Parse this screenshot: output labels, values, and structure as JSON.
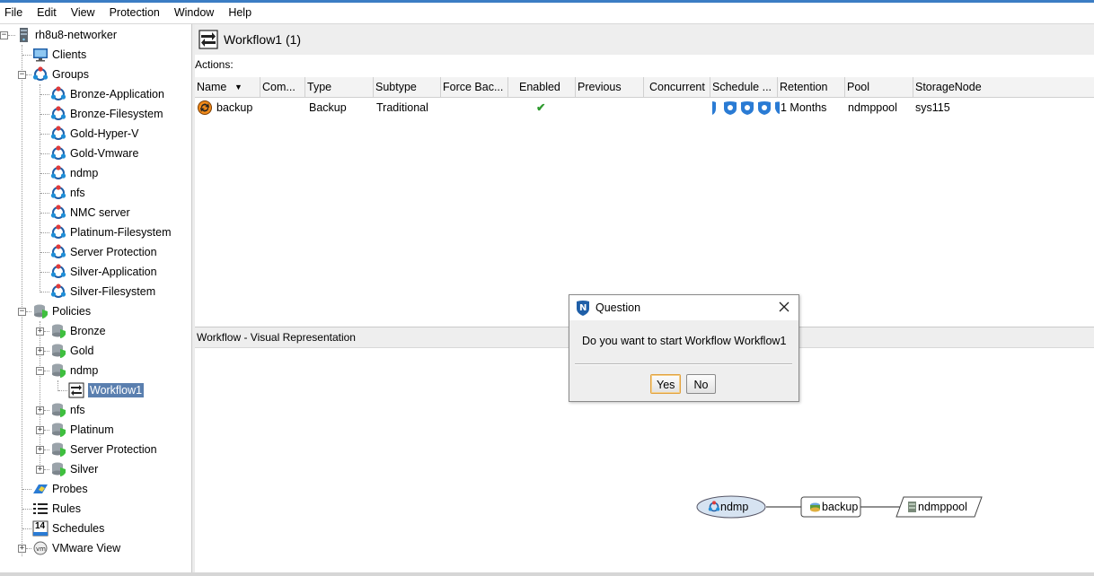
{
  "menu": [
    "File",
    "Edit",
    "View",
    "Protection",
    "Window",
    "Help"
  ],
  "tree": {
    "root": "rh8u8-networker",
    "clients": "Clients",
    "groups": "Groups",
    "group_items": [
      "Bronze-Application",
      "Bronze-Filesystem",
      "Gold-Hyper-V",
      "Gold-Vmware",
      "ndmp",
      "nfs",
      "NMC server",
      "Platinum-Filesystem",
      "Server Protection",
      "Silver-Application",
      "Silver-Filesystem"
    ],
    "policies": "Policies",
    "policy_items": [
      "Bronze",
      "Gold",
      "ndmp",
      "nfs",
      "Platinum",
      "Server Protection",
      "Silver"
    ],
    "selected_workflow": "Workflow1",
    "probes": "Probes",
    "rules": "Rules",
    "schedules": "Schedules",
    "schedules_icon_text": "14",
    "vmware": "VMware View"
  },
  "header": {
    "title": "Workflow1 (1)"
  },
  "actions_label": "Actions:",
  "table": {
    "columns": [
      "Name",
      "Com...",
      "Type",
      "Subtype",
      "Force Bac...",
      "Enabled",
      "Previous",
      "Concurrent",
      "Schedule ...",
      "Retention",
      "Pool",
      "StorageNode"
    ],
    "row": {
      "name": "backup",
      "type": "Backup",
      "subtype": "Traditional",
      "enabled": "✔",
      "retention": "1 Months",
      "pool": "ndmppool",
      "storage_node": "sys115"
    }
  },
  "visual": {
    "header": "Workflow - Visual Representation",
    "group_node": "ndmp",
    "action_node": "backup",
    "pool_node": "ndmppool"
  },
  "dialog": {
    "title": "Question",
    "message": "Do you want to start Workflow Workflow1",
    "yes": "Yes",
    "no": "No"
  },
  "colors": {
    "accent": "#3b7dc4",
    "selection": "#5a7faf",
    "enabled_check": "#2e9a2e"
  }
}
